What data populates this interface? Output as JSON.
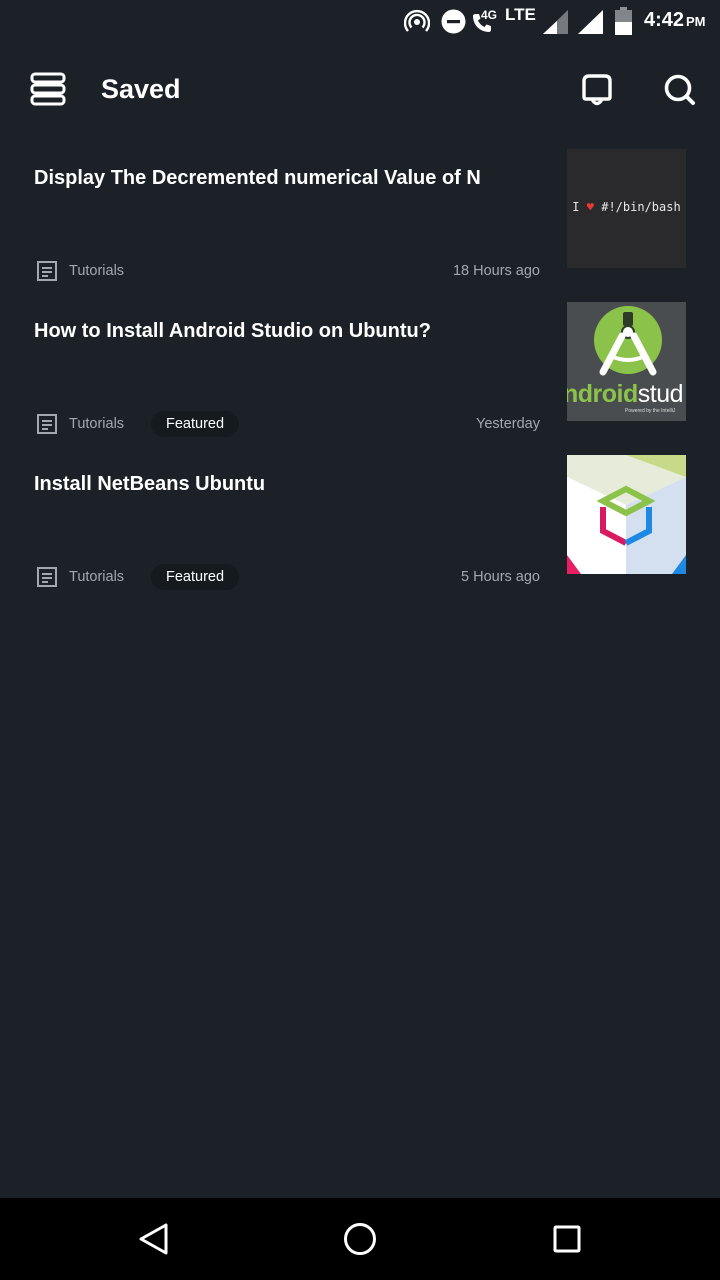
{
  "status_bar": {
    "network_label": "4G",
    "lte_label": "LTE",
    "time": "4:42",
    "ampm": "PM",
    "icons": [
      "hotspot-icon",
      "do-not-disturb-icon",
      "wifi-calling-icon",
      "signal-icon",
      "battery-icon"
    ]
  },
  "header": {
    "title": "Saved",
    "icons": [
      "menu-icon",
      "notification-icon",
      "search-icon"
    ]
  },
  "articles": [
    {
      "title": "Display The Decremented numerical Value of N",
      "category": "Tutorials",
      "badge": "",
      "time": "18 Hours ago",
      "thumb_text_1": "I",
      "thumb_heart": "♥",
      "thumb_text_2": "#!/bin/bash"
    },
    {
      "title": "How to Install Android Studio on Ubuntu?",
      "category": "Tutorials",
      "badge": "Featured",
      "time": "Yesterday",
      "thumb_text": "ndroid stud",
      "thumb_caption": "Powered by the IntelliJ"
    },
    {
      "title": "Install NetBeans Ubuntu",
      "category": "Tutorials",
      "badge": "Featured",
      "time": "5 Hours ago"
    }
  ],
  "colors": {
    "background": "#1c2128",
    "secondary_text": "#a3a8ae",
    "badge_bg": "#151a1f",
    "android_green": "#8bc34a"
  },
  "nav_bar": {
    "icons": [
      "back-icon",
      "home-icon",
      "recents-icon"
    ]
  }
}
